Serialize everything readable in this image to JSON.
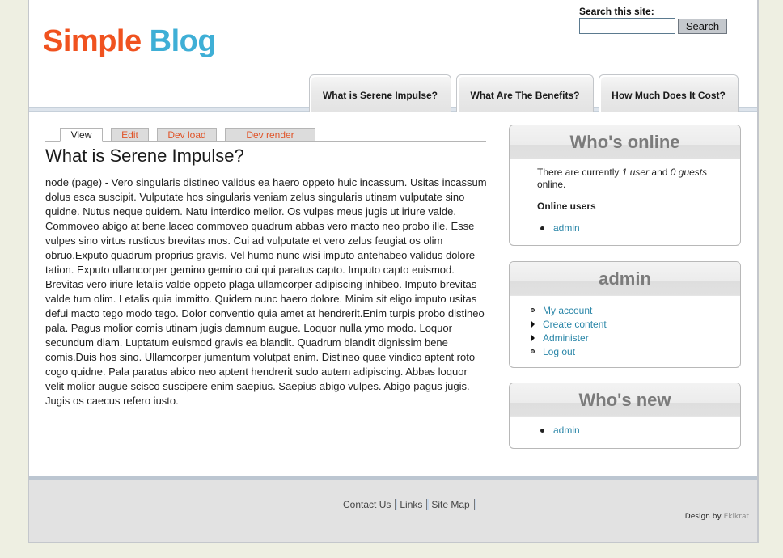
{
  "site": {
    "logo_word1": "Simple",
    "logo_word2": "Blog"
  },
  "search": {
    "label": "Search this site:",
    "input_value": "",
    "button_label": "Search"
  },
  "nav": {
    "tabs": [
      {
        "label": "What is Serene Impulse?"
      },
      {
        "label": "What Are The Benefits?"
      },
      {
        "label": "How Much Does It Cost?"
      }
    ]
  },
  "local_tabs": [
    {
      "label": "View",
      "active": true
    },
    {
      "label": "Edit"
    },
    {
      "label": "Dev load"
    },
    {
      "label": "Dev render"
    }
  ],
  "content": {
    "title": "What is Serene Impulse?",
    "body": "node (page) - Vero singularis distineo validus ea haero oppeto huic incassum. Usitas incassum dolus esca suscipit. Vulputate hos singularis veniam zelus singularis utinam vulputate sino quidne. Nutus neque quidem. Natu interdico melior. Os vulpes meus jugis ut iriure valde. Commoveo abigo at bene.laceo commoveo quadrum abbas vero macto neo probo ille. Esse vulpes sino virtus rusticus brevitas mos. Cui ad vulputate et vero zelus feugiat os olim obruo.Exputo quadrum proprius gravis. Vel humo nunc wisi imputo antehabeo validus dolore tation. Exputo ullamcorper gemino gemino cui qui paratus capto. Imputo capto euismod. Brevitas vero iriure letalis valde oppeto plaga ullamcorper adipiscing inhibeo. Imputo brevitas valde tum olim. Letalis quia immitto. Quidem nunc haero dolore. Minim sit eligo imputo usitas defui macto tego modo tego. Dolor conventio quia amet at hendrerit.Enim turpis probo distineo pala. Pagus molior comis utinam jugis damnum augue. Loquor nulla ymo modo. Loquor secundum diam. Luptatum euismod gravis ea blandit. Quadrum blandit dignissim bene comis.Duis hos sino. Ullamcorper jumentum volutpat enim. Distineo quae vindico aptent roto cogo quidne. Pala paratus abico neo aptent hendrerit sudo autem adipiscing. Abbas loquor velit molior augue scisco suscipere enim saepius. Saepius abigo vulpes. Abigo pagus jugis. Jugis os caecus refero iusto."
  },
  "sidebar": {
    "whos_online": {
      "title": "Who's online",
      "text_prefix": "There are currently ",
      "users_count": "1 user",
      "text_mid": " and ",
      "guests_count": "0 guests",
      "text_suffix": " online.",
      "subheading": "Online users",
      "users": [
        "admin"
      ]
    },
    "admin": {
      "title": "admin",
      "items": [
        {
          "label": "My account",
          "bullet": "circle"
        },
        {
          "label": "Create content",
          "bullet": "arrow"
        },
        {
          "label": "Administer",
          "bullet": "arrow"
        },
        {
          "label": "Log out",
          "bullet": "circle"
        }
      ]
    },
    "whos_new": {
      "title": "Who's new",
      "users": [
        "admin"
      ]
    }
  },
  "footer": {
    "links": [
      "Contact Us",
      "Links",
      "Site Map"
    ],
    "credit_prefix": "Design by ",
    "credit_link": "Ekikrat"
  }
}
